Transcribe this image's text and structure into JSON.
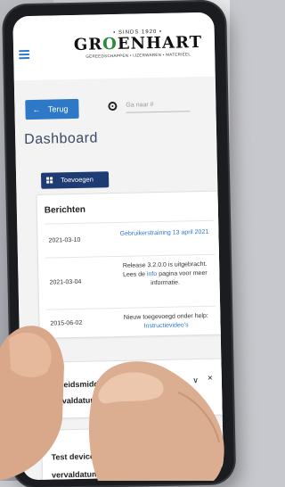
{
  "header": {
    "since": "• SINDS 1920 •",
    "brand_before": "GR",
    "brand_mark": "O",
    "brand_after": "ENHART",
    "tagline": "GEREEDSCHAPPEN • IJZERWAREN • MATERIEEL"
  },
  "nav": {
    "back_label": "Terug",
    "goto_placeholder": "Ga naar #"
  },
  "page": {
    "title": "Dashboard",
    "add_label": "Toevoegen"
  },
  "berichten": {
    "title": "Berichten",
    "rows": [
      {
        "date": "2021-03-10",
        "text": "Gebruikerstraining 13 april 2021"
      },
      {
        "date": "2021-03-04",
        "text_pre": "Release 3.2.0.0 is uitgebracht. Lees de ",
        "link": "info",
        "text_post": " pagina voor meer informatie."
      },
      {
        "date": "2015-06-02",
        "text_pre": "Nieuw toegevoegd onder help: ",
        "link": "Instructievideo's",
        "text_post": ""
      }
    ]
  },
  "cards": {
    "arbeid": {
      "line1": "Arbeidsmiddel",
      "line2": "vervaldatum"
    },
    "device": {
      "line1": "Test device",
      "line2": "vervaldatum"
    }
  },
  "icons": {
    "menu": "hamburger-icon",
    "back": "arrow-left-icon",
    "target": "target-icon",
    "add": "grid-add-icon",
    "chevron": "chevron-down-icon",
    "close": "close-icon"
  },
  "colors": {
    "accent": "#2e78c8",
    "dark_button": "#1f3b73",
    "brand_green": "#2c8a3e"
  }
}
